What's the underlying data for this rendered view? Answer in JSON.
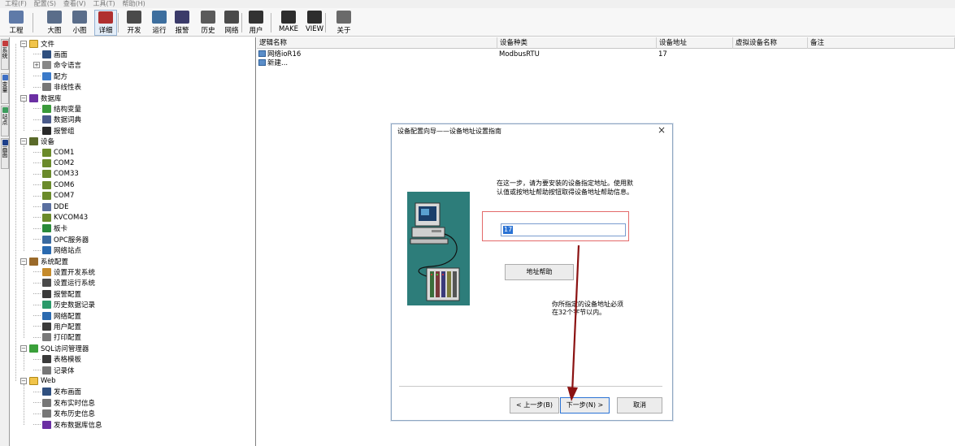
{
  "menubar": {
    "items": [
      "工程(F)",
      "配置(S)",
      "查看(V)",
      "工具(T)",
      "帮助(H)"
    ]
  },
  "toolbar": {
    "buttons": [
      {
        "label": "工程",
        "icon": "project-icon"
      },
      {
        "label": "大图",
        "icon": "large-icons-icon"
      },
      {
        "label": "小图",
        "icon": "small-icons-icon"
      },
      {
        "label": "详细",
        "icon": "details-icon"
      },
      {
        "label": "开发",
        "icon": "develop-icon"
      },
      {
        "label": "运行",
        "icon": "run-icon"
      },
      {
        "label": "报警",
        "icon": "alarm-icon"
      },
      {
        "label": "历史",
        "icon": "history-icon"
      },
      {
        "label": "网络",
        "icon": "network-icon"
      },
      {
        "label": "用户",
        "icon": "user-icon"
      },
      {
        "label": "MAKE",
        "icon": "make-icon"
      },
      {
        "label": "VIEW",
        "icon": "view-icon"
      },
      {
        "label": "关于",
        "icon": "about-icon"
      }
    ]
  },
  "vtabs": [
    "系统",
    "变量",
    "站点",
    "画面"
  ],
  "tree": [
    {
      "label": "文件",
      "icon": "folder-icon",
      "level": 0,
      "exp": "minus"
    },
    {
      "label": "画面",
      "icon": "screen-icon",
      "level": 1
    },
    {
      "label": "命令语言",
      "icon": "command-icon",
      "level": 1,
      "exp": "plus"
    },
    {
      "label": "配方",
      "icon": "recipe-icon",
      "level": 1
    },
    {
      "label": "非线性表",
      "icon": "table-icon",
      "level": 1
    },
    {
      "label": "数据库",
      "icon": "database-icon",
      "level": 0,
      "exp": "minus"
    },
    {
      "label": "结构变量",
      "icon": "struct-var-icon",
      "level": 1
    },
    {
      "label": "数据词典",
      "icon": "dictionary-icon",
      "level": 1
    },
    {
      "label": "报警组",
      "icon": "alarm-group-icon",
      "level": 1
    },
    {
      "label": "设备",
      "icon": "device-icon",
      "level": 0,
      "exp": "minus"
    },
    {
      "label": "COM1",
      "icon": "com-port-icon",
      "level": 1
    },
    {
      "label": "COM2",
      "icon": "com-port-icon",
      "level": 1
    },
    {
      "label": "COM33",
      "icon": "com-port-icon",
      "level": 1
    },
    {
      "label": "COM6",
      "icon": "com-port-icon",
      "level": 1
    },
    {
      "label": "COM7",
      "icon": "com-port-icon",
      "level": 1
    },
    {
      "label": "DDE",
      "icon": "dde-icon",
      "level": 1
    },
    {
      "label": "KVCOM43",
      "icon": "com-port-icon",
      "level": 1
    },
    {
      "label": "板卡",
      "icon": "board-card-icon",
      "level": 1
    },
    {
      "label": "OPC服务器",
      "icon": "opc-server-icon",
      "level": 1
    },
    {
      "label": "网络站点",
      "icon": "network-site-icon",
      "level": 1
    },
    {
      "label": "系统配置",
      "icon": "system-config-icon",
      "level": 0,
      "exp": "minus"
    },
    {
      "label": "设置开发系统",
      "icon": "dev-settings-icon",
      "level": 1
    },
    {
      "label": "设置运行系统",
      "icon": "run-settings-icon",
      "level": 1
    },
    {
      "label": "报警配置",
      "icon": "alarm-config-icon",
      "level": 1
    },
    {
      "label": "历史数据记录",
      "icon": "history-record-icon",
      "level": 1
    },
    {
      "label": "网络配置",
      "icon": "network-config-icon",
      "level": 1
    },
    {
      "label": "用户配置",
      "icon": "user-config-icon",
      "level": 1
    },
    {
      "label": "打印配置",
      "icon": "print-config-icon",
      "level": 1
    },
    {
      "label": "SQL访问管理器",
      "icon": "sql-manager-icon",
      "level": 0,
      "exp": "minus"
    },
    {
      "label": "表格模板",
      "icon": "table-template-icon",
      "level": 1
    },
    {
      "label": "记录体",
      "icon": "record-icon",
      "level": 1
    },
    {
      "label": "Web",
      "icon": "folder-icon",
      "level": 0,
      "exp": "minus"
    },
    {
      "label": "发布画面",
      "icon": "publish-screen-icon",
      "level": 1
    },
    {
      "label": "发布实时信息",
      "icon": "publish-realtime-icon",
      "level": 1
    },
    {
      "label": "发布历史信息",
      "icon": "publish-history-icon",
      "level": 1
    },
    {
      "label": "发布数据库信息",
      "icon": "publish-db-icon",
      "level": 1
    }
  ],
  "grid": {
    "columns": [
      "逻辑名称",
      "设备种类",
      "设备地址",
      "虚拟设备名称",
      "备注"
    ],
    "rows": [
      [
        "网络ioR16",
        "ModbusRTU",
        "17",
        "",
        ""
      ],
      [
        "新建...",
        "",
        "",
        "",
        ""
      ]
    ]
  },
  "dialog": {
    "title": "设备配置向导——设备地址设置指南",
    "close": "×",
    "instruction_line1": "在这一步，请为要安装的设备指定地址。使用默",
    "instruction_line2": "认值或按地址帮助按钮取得设备地址帮助信息。",
    "address_value": "17",
    "help_button": "地址帮助",
    "info_line1": "你所指定的设备地址必须",
    "info_line2": "在32个字节以内。",
    "back_button": "< 上一步(B)",
    "next_button": "下一步(N) >",
    "cancel_button": "取消"
  },
  "colors": {
    "selection": "#2a72d4",
    "highlight_border": "#e36a6a",
    "arrow": "#8b1212",
    "wizard_bg": "#2d7d7a"
  }
}
